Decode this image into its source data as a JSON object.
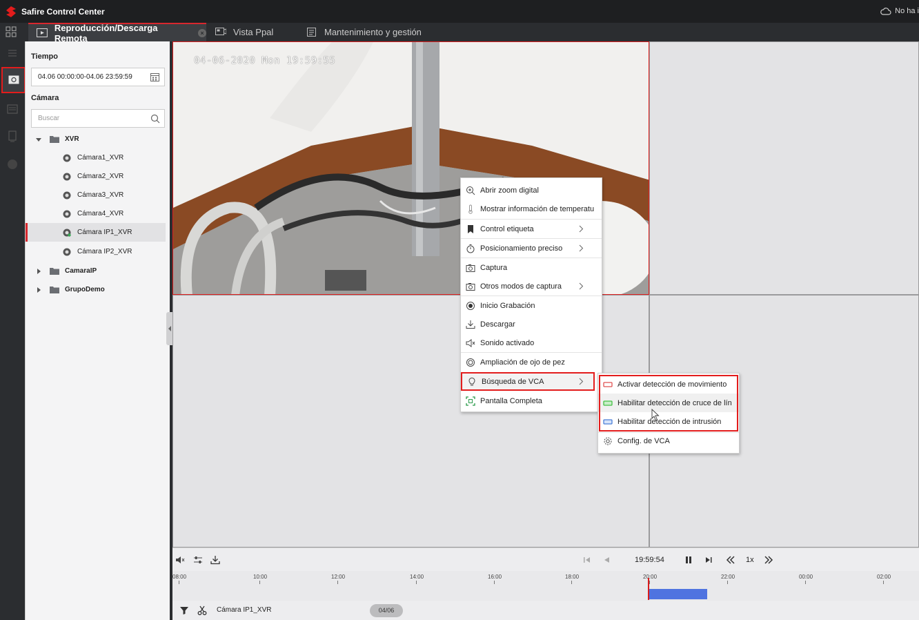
{
  "app": {
    "title": "Safire Control Center",
    "cloud_status": "No ha i"
  },
  "tabs": [
    {
      "label": "Reproducción/Descarga Remota",
      "active": true
    },
    {
      "label": "Vista Ppal",
      "active": false
    },
    {
      "label": "Mantenimiento y gestión",
      "active": false
    }
  ],
  "left_panel": {
    "time_label": "Tiempo",
    "time_range": "04.06 00:00:00-04.06 23:59:59",
    "camera_label": "Cámara",
    "search_placeholder": "Buscar",
    "tree": {
      "xvr": {
        "label": "XVR",
        "cameras": [
          "Cámara1_XVR",
          "Cámara2_XVR",
          "Cámara3_XVR",
          "Cámara4_XVR",
          "Cámara IP1_XVR",
          "Cámara IP2_XVR"
        ],
        "selected": "Cámara IP1_XVR"
      },
      "groups": [
        "CamaraIP",
        "GrupoDemo"
      ]
    }
  },
  "video": {
    "osd_timestamp": "04-06-2020 Mon 19:59:55"
  },
  "context_menu": {
    "items": [
      {
        "label": "Abrir zoom digital",
        "icon": "zoom-icon",
        "submenu": false
      },
      {
        "label": "Mostrar información de temperatu",
        "icon": "thermometer-icon",
        "submenu": false
      },
      {
        "label": "Control etiqueta",
        "icon": "bookmark-icon",
        "submenu": true
      },
      {
        "label": "Posicionamiento preciso",
        "icon": "stopwatch-icon",
        "submenu": true
      },
      {
        "label": "Captura",
        "icon": "camera-icon",
        "submenu": false
      },
      {
        "label": "Otros modos de captura",
        "icon": "camera-icon",
        "submenu": true
      },
      {
        "label": "Inicio Grabación",
        "icon": "record-icon",
        "submenu": false
      },
      {
        "label": "Descargar",
        "icon": "download-icon",
        "submenu": false
      },
      {
        "label": "Sonido activado",
        "icon": "speaker-icon",
        "submenu": false
      },
      {
        "label": "Ampliación de ojo de pez",
        "icon": "fisheye-icon",
        "submenu": false
      },
      {
        "label": "Búsqueda de VCA",
        "icon": "lightbulb-icon",
        "submenu": true
      },
      {
        "label": "Pantalla Completa",
        "icon": "fullscreen-icon",
        "submenu": false
      }
    ]
  },
  "vca_submenu": {
    "items": [
      {
        "label": "Activar detección de movimiento",
        "color": "#e05050"
      },
      {
        "label": "Habilitar detección de cruce de lín",
        "color": "#44c044"
      },
      {
        "label": "Habilitar detección de intrusión",
        "color": "#4a7ed8"
      },
      {
        "label": "Config. de VCA",
        "icon": "gear-icon"
      }
    ]
  },
  "playback": {
    "time": "19:59:54",
    "speed": "1x"
  },
  "timeline": {
    "ticks": [
      "08:00",
      "10:00",
      "12:00",
      "14:00",
      "16:00",
      "18:00",
      "20:00",
      "22:00",
      "00:00",
      "02:00"
    ]
  },
  "bottom": {
    "camera": "Cámara IP1_XVR",
    "date": "04/06"
  },
  "colors": {
    "accent_red": "#d9272e",
    "record_blue": "#4f73e0"
  }
}
